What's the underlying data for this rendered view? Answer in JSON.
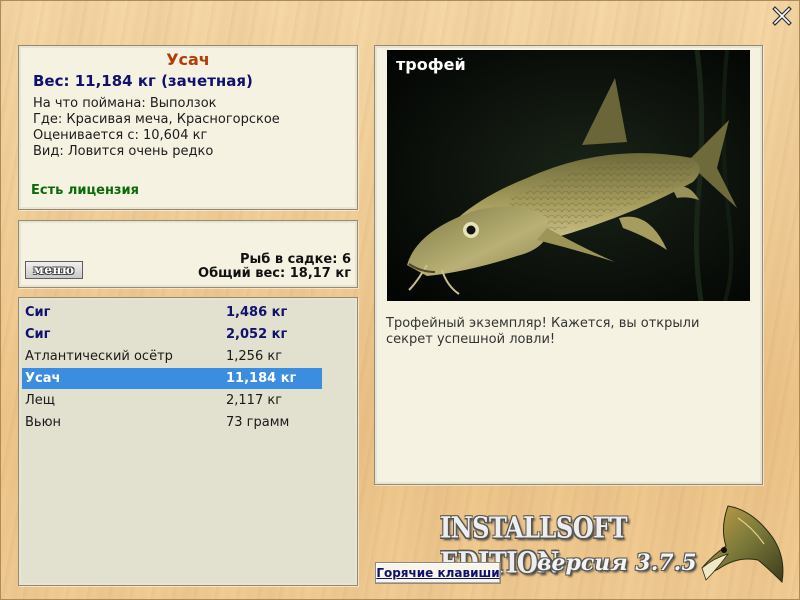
{
  "info": {
    "name": "Усач",
    "weight": "Вес: 11,184 кг (зачетная)",
    "lines": [
      "На что поймана: Выползок",
      "Где: Красивая меча, Красногорское",
      "Оценивается с: 10,604 кг",
      "Вид: Ловится очень редко"
    ],
    "license": "Есть лицензия"
  },
  "stats": {
    "menu_label": "меню",
    "fish_count": "Рыб в садке: 6",
    "total_weight": "Общий вес: 18,17 кг"
  },
  "catch_list": [
    {
      "name": "Сиг",
      "weight": "1,486 кг",
      "style": "bold"
    },
    {
      "name": "Сиг",
      "weight": "2,052 кг",
      "style": "bold"
    },
    {
      "name": "Атлантический осётр",
      "weight": "1,256 кг",
      "style": "normal"
    },
    {
      "name": "Усач",
      "weight": "11,184 кг",
      "style": "selected"
    },
    {
      "name": "Лещ",
      "weight": "2,117 кг",
      "style": "normal"
    },
    {
      "name": "Вьюн",
      "weight": "73 грамм",
      "style": "normal"
    }
  ],
  "photo": {
    "trophy_label": "трофей",
    "description": "Трофейный экземпляр! Кажется, вы открыли секрет успешной ловли!"
  },
  "brand": {
    "edition": "INSTALLSOFT EDITION",
    "version": "версия 3.7.5"
  },
  "buttons": {
    "hotkeys": "Горячие клавиши",
    "close_icon": "close-x-icon"
  },
  "colors": {
    "selected_row": "#3b8de0",
    "fish_name": "#b33c06",
    "weight_text": "#10106e",
    "license_text": "#0b6a0b"
  }
}
